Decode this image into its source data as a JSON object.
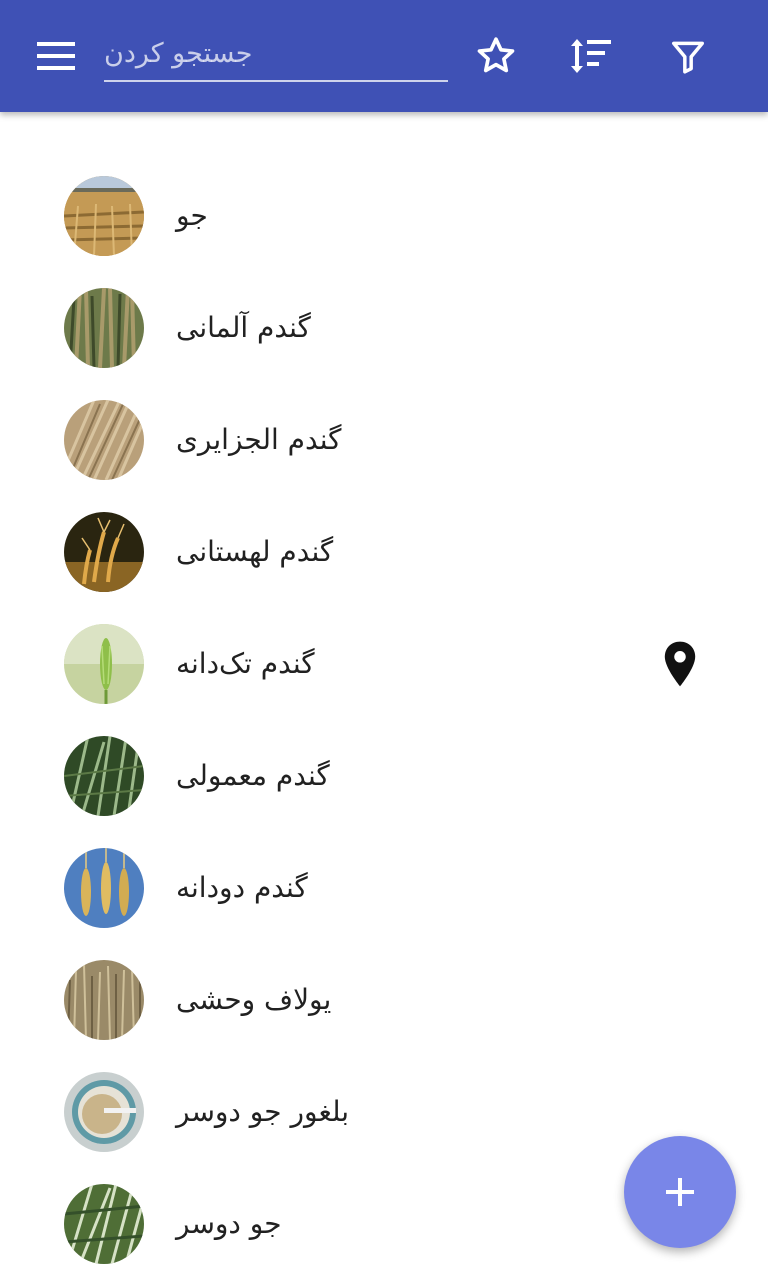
{
  "toolbar": {
    "menu_icon": "menu-icon",
    "search_placeholder": "جستجو کردن",
    "search_value": "",
    "favorites_icon": "star-outline-icon",
    "sort_icon": "sort-icon",
    "filter_icon": "filter-icon",
    "bar_color": "#3f51b5"
  },
  "list": {
    "items": [
      {
        "label": "جو",
        "thumb": "barley-field-photo",
        "has_location": false
      },
      {
        "label": "گندم آلمانی",
        "thumb": "emmer-wheat-photo",
        "has_location": false
      },
      {
        "label": "گندم الجزایری",
        "thumb": "durum-wheat-photo",
        "has_location": false
      },
      {
        "label": "گندم لهستانی",
        "thumb": "polish-wheat-photo",
        "has_location": false
      },
      {
        "label": "گندم تک‌دانه",
        "thumb": "einkorn-wheat-photo",
        "has_location": true
      },
      {
        "label": "گندم معمولی",
        "thumb": "common-wheat-photo",
        "has_location": false
      },
      {
        "label": "گندم دودانه",
        "thumb": "emmer-ears-photo",
        "has_location": false
      },
      {
        "label": "یولاف وحشی",
        "thumb": "wild-oat-photo",
        "has_location": false
      },
      {
        "label": "بلغور جو دوسر",
        "thumb": "oatmeal-bowl-photo",
        "has_location": false
      },
      {
        "label": "جو دوسر",
        "thumb": "oat-plant-photo",
        "has_location": false
      }
    ]
  },
  "fab": {
    "icon": "plus-icon",
    "color": "#7986e8"
  }
}
